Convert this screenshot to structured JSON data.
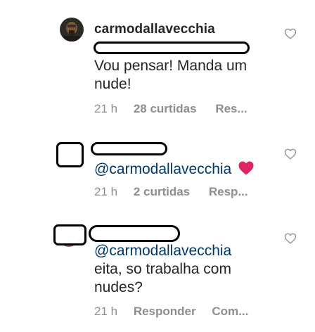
{
  "comments": [
    {
      "username": "carmodallavecchia",
      "text": "Vou pensar! Manda um nude!",
      "text_lines": [
        "Vou pensar! Manda um",
        "nude!"
      ],
      "time": "21 h",
      "likes": "28 curtidas",
      "reply": "Res...",
      "like_icon": "heart-outline-icon"
    },
    {
      "mention": "@carmodallavecchia",
      "emoji": "red-heart-emoji",
      "time": "21 h",
      "likes": "2 curtidas",
      "reply": "Resp...",
      "like_icon": "heart-outline-icon"
    },
    {
      "mention": "@carmodallavecchia",
      "text_lines": [
        "eita, so trabalha com",
        "nudes?"
      ],
      "time": "21 h",
      "reply": "Responder",
      "more": "Com...",
      "like_icon": "heart-outline-icon"
    }
  ],
  "colors": {
    "text": "#262626",
    "muted": "#8e8e8e",
    "mention": "#00376b",
    "heart_emoji": "#e0245e"
  }
}
